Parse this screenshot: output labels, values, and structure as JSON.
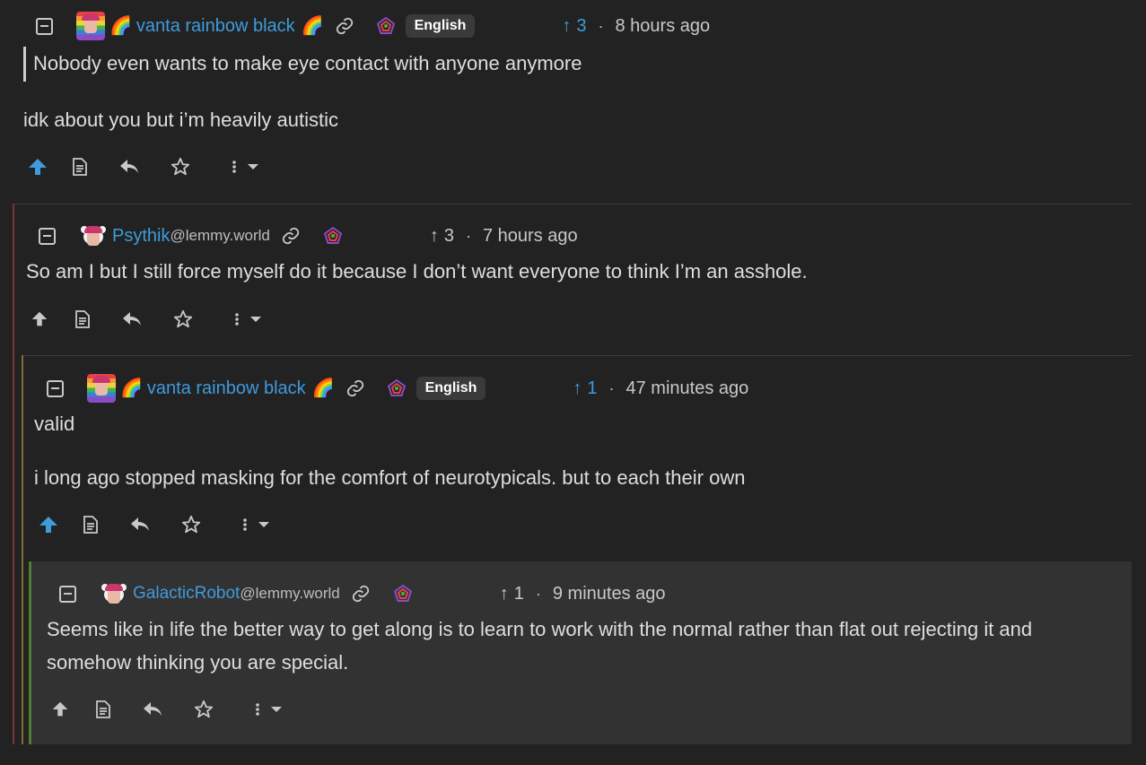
{
  "comments": [
    {
      "author": "vanta rainbow black",
      "author_emoji": "🌈",
      "language": "English",
      "score": "3",
      "time": "8 hours ago",
      "quote": "Nobody even wants to make eye contact with anyone anymore",
      "body": "idk about you but i’m heavily autistic",
      "upvoted": true
    },
    {
      "author": "Psythik",
      "instance": "@lemmy.world",
      "score": "3",
      "time": "7 hours ago",
      "body": "So am I but I still force myself do it because I don’t want everyone to think I’m an asshole.",
      "upvoted": false
    },
    {
      "author": "vanta rainbow black",
      "author_emoji": "🌈",
      "language": "English",
      "score": "1",
      "time": "47 minutes ago",
      "body_1": "valid",
      "body_2": "i long ago stopped masking for the comfort of neurotypicals. but to each their own",
      "upvoted": true
    },
    {
      "author": "GalacticRobot",
      "instance": "@lemmy.world",
      "score": "1",
      "time": "9 minutes ago",
      "body_1": "Seems like in life the better way to get along is to learn to work with the normal rather than flat out rejecting it and",
      "body_2": "somehow thinking you are special.",
      "upvoted": false
    }
  ],
  "separator": "·",
  "icons": {
    "collapse": "collapse-icon",
    "link": "link-icon",
    "federation": "fediverse-icon",
    "upvote": "upvote-icon",
    "source": "view-source-icon",
    "reply": "reply-icon",
    "save": "star-icon",
    "more": "more-options-icon"
  },
  "colors": {
    "background": "#222222",
    "highlight": "#323232",
    "link": "#3f9bdc",
    "thread_1": "#8a3a3a",
    "thread_2": "#8a7a3a",
    "thread_3": "#5a8a3a"
  }
}
